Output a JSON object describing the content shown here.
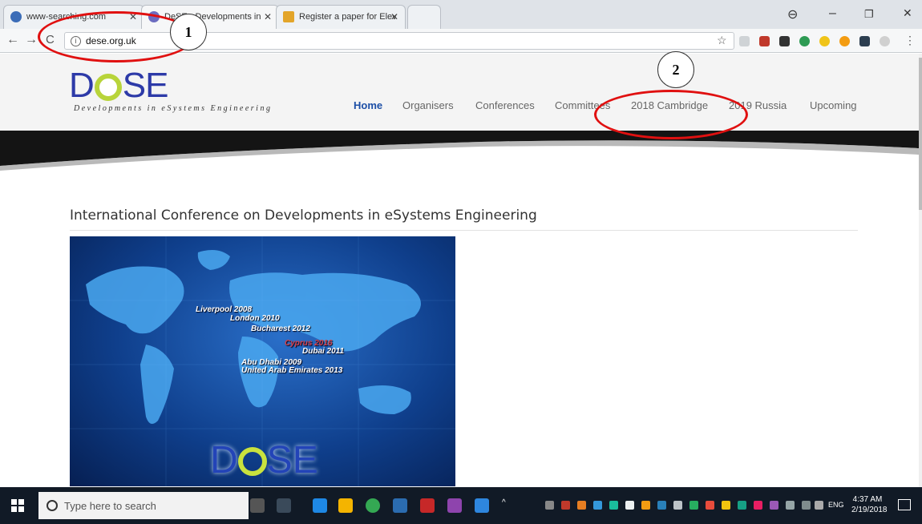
{
  "browser": {
    "tabs": [
      {
        "title": "www-searching.com",
        "favicon_color": "#3b6cb7"
      },
      {
        "title": "DeSE - Developments in",
        "favicon_color": "#6c6cc0"
      },
      {
        "title": "Register a paper for Elev",
        "favicon_color": "#e3a52a"
      }
    ],
    "url": "dese.org.uk",
    "info_glyph": "i"
  },
  "site": {
    "logo_d": "D",
    "logo_se": "SE",
    "tagline": "Developments in eSystems Engineering",
    "nav": [
      {
        "label": "Home",
        "active": true
      },
      {
        "label": "Organisers"
      },
      {
        "label": "Conferences"
      },
      {
        "label": "Committees"
      },
      {
        "label": "2018 Cambridge"
      },
      {
        "label": "2019 Russia"
      },
      {
        "label": "Upcoming"
      }
    ],
    "headline": "International Conference on Developments in eSystems Engineering",
    "hero": {
      "cities": [
        {
          "label": "Liverpool 2008"
        },
        {
          "label": "London 2010"
        },
        {
          "label": "Bucharest 2012"
        },
        {
          "label": "Cyprus 2016"
        },
        {
          "label": "Dubai 2011"
        },
        {
          "label": "Abu Dhabi 2009"
        },
        {
          "label": "United Arab Emirates 2013"
        }
      ],
      "logo_d": "D",
      "logo_se": "SE"
    }
  },
  "annotations": [
    {
      "number": "1"
    },
    {
      "number": "2"
    }
  ],
  "taskbar": {
    "search_placeholder": "Type here to search",
    "language": "ENG",
    "time": "4:37 AM",
    "date": "2/19/2018"
  }
}
